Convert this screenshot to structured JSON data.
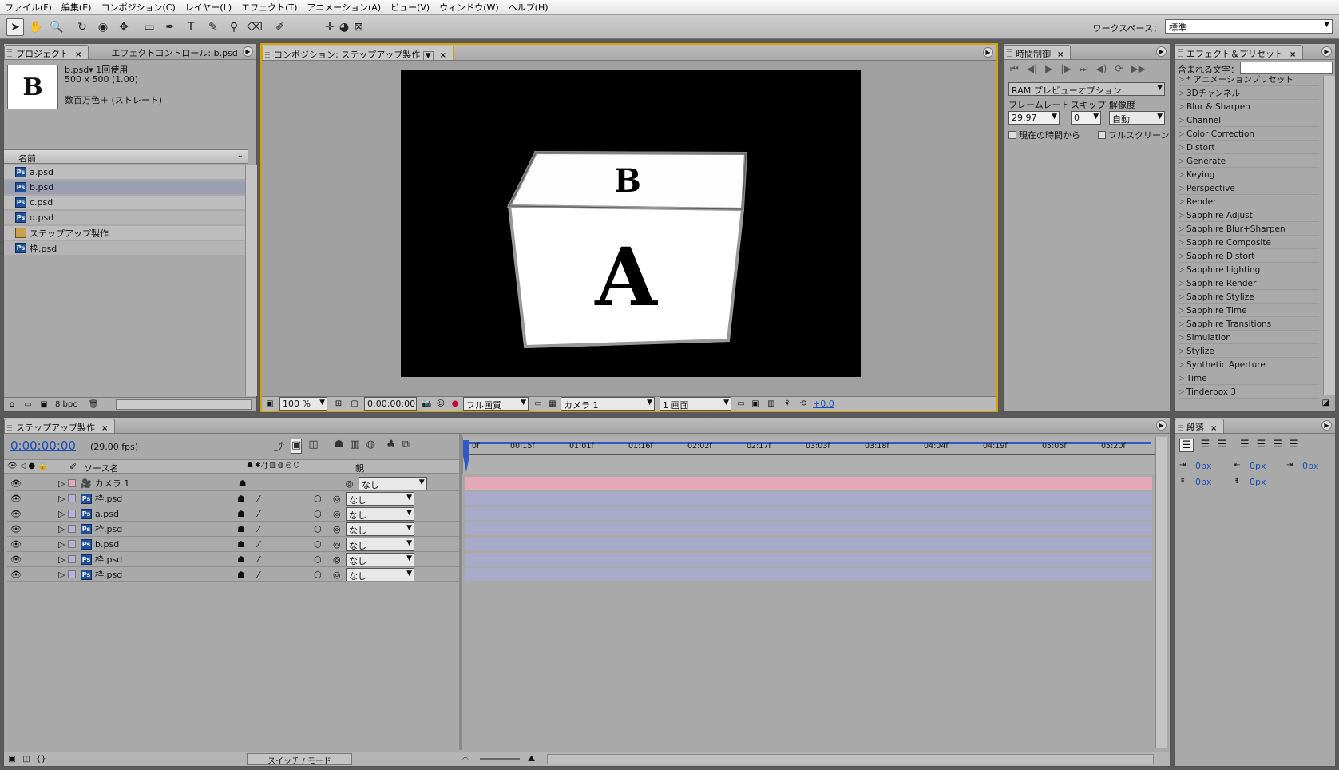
{
  "menu": [
    "ファイル(F)",
    "編集(E)",
    "コンポジション(C)",
    "レイヤー(L)",
    "エフェクト(T)",
    "アニメーション(A)",
    "ビュー(V)",
    "ウィンドウ(W)",
    "ヘルプ(H)"
  ],
  "workspace": {
    "label": "ワークスペース：",
    "value": "標準"
  },
  "project": {
    "tabs": [
      "プロジェクト",
      "エフェクトコントロール: b.psd"
    ],
    "thumb_letter": "B",
    "info_name": "b.psd▾ 1回使用",
    "info_size": "500 x 500 (1.00)",
    "info_color": "数百万色＋ (ストレート)",
    "column_name": "名前",
    "items": [
      "a.psd",
      "b.psd",
      "c.psd",
      "d.psd",
      "ステップアップ製作",
      "枠.psd"
    ],
    "bpc": "8 bpc"
  },
  "composition": {
    "tab": "コンポジション: ステップアップ製作",
    "cube_top": "B",
    "cube_front": "A",
    "zoom": "100 %",
    "time": "0:00:00:00",
    "quality": "フル画質",
    "camera": "カメラ 1",
    "views": "1 画面",
    "exposure": "+0.0"
  },
  "time_control": {
    "tab": "時間制御",
    "ram_preview": "RAM プレビューオプション",
    "framerate_label": "フレームレート",
    "skip_label": "スキップ",
    "resolution_label": "解像度",
    "framerate": "29.97",
    "skip": "0",
    "resolution": "自動",
    "from_current": "現在の時間から",
    "fullscreen": "フルスクリーン"
  },
  "effects": {
    "tab": "エフェクト＆プリセット",
    "contains_label": "含まれる文字：",
    "items": [
      "* アニメーションプリセット",
      "3Dチャンネル",
      "Blur & Sharpen",
      "Channel",
      "Color Correction",
      "Distort",
      "Generate",
      "Keying",
      "Perspective",
      "Render",
      "Sapphire Adjust",
      "Sapphire Blur+Sharpen",
      "Sapphire Composite",
      "Sapphire Distort",
      "Sapphire Lighting",
      "Sapphire Render",
      "Sapphire Stylize",
      "Sapphire Time",
      "Sapphire Transitions",
      "Simulation",
      "Stylize",
      "Synthetic Aperture",
      "Time",
      "Tinderbox 3"
    ]
  },
  "timeline": {
    "tab": "ステップアップ製作",
    "timecode": "0:00:00:00",
    "fps": "(29.00 fps)",
    "source_header": "ソース名",
    "parent_header": "親",
    "ruler": [
      "0f",
      "00:15f",
      "01:01f",
      "01:16f",
      "02:02f",
      "02:17f",
      "03:03f",
      "03:18f",
      "04:04f",
      "04:19f",
      "05:05f",
      "05:20f"
    ],
    "layers": [
      {
        "name": "カメラ 1",
        "type": "camera",
        "parent": "なし"
      },
      {
        "name": "枠.psd",
        "type": "psd",
        "parent": "なし"
      },
      {
        "name": "a.psd",
        "type": "psd",
        "parent": "なし"
      },
      {
        "name": "枠.psd",
        "type": "psd",
        "parent": "なし"
      },
      {
        "name": "b.psd",
        "type": "psd",
        "parent": "なし"
      },
      {
        "name": "枠.psd",
        "type": "psd",
        "parent": "なし"
      },
      {
        "name": "枠.psd",
        "type": "psd",
        "parent": "なし"
      }
    ],
    "switch_mode": "スイッチ / モード"
  },
  "paragraph": {
    "tab": "段落",
    "values": [
      "0px",
      "0px",
      "0px",
      "0px",
      "0px"
    ]
  },
  "colors": {
    "camera_bar": "#e3a9b8",
    "layer_bar": "#a9a9c9",
    "accent_yellow": "#d4a300",
    "timecode_blue": "#1b4fb5"
  }
}
